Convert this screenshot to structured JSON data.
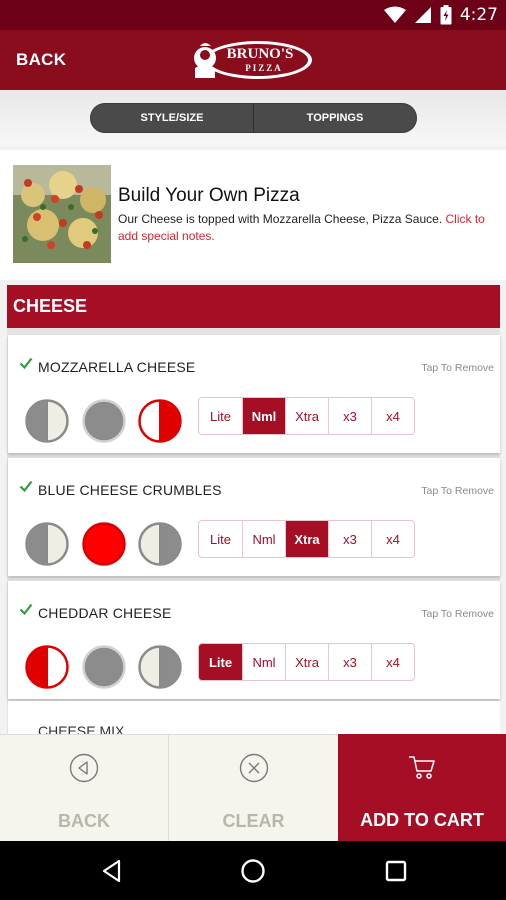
{
  "status_bar": {
    "time": "4:27"
  },
  "header": {
    "back_label": "BACK",
    "logo_text_top": "BRUNO'S",
    "logo_text_bottom": "PIZZA"
  },
  "tabs": [
    {
      "label": "STYLE/SIZE"
    },
    {
      "label": "TOPPINGS"
    }
  ],
  "product": {
    "title": "Build Your Own Pizza",
    "description": "Our Cheese is topped with Mozzarella Cheese, Pizza Sauce.",
    "note_link": "Click to add special notes."
  },
  "section": {
    "title": "CHEESE"
  },
  "amount_options": [
    "Lite",
    "Nml",
    "Xtra",
    "x3",
    "x4"
  ],
  "toppings": [
    {
      "name": "MOZZARELLA CHEESE",
      "remove_label": "Tap To Remove",
      "selected_coverage": "right",
      "selected_amount": "Nml"
    },
    {
      "name": "BLUE CHEESE CRUMBLES",
      "remove_label": "Tap To Remove",
      "selected_coverage": "whole",
      "selected_amount": "Xtra"
    },
    {
      "name": "CHEDDAR CHEESE",
      "remove_label": "Tap To Remove",
      "selected_coverage": "left",
      "selected_amount": "Lite"
    }
  ],
  "partial_item": {
    "name": "CHEESE MIX"
  },
  "bottom_bar": {
    "back_label": "BACK",
    "clear_label": "CLEAR",
    "cart_label": "ADD TO CART"
  },
  "colors": {
    "brand": "#a50e24",
    "header": "#8a0d1e",
    "status_bar": "#6b0016",
    "selected_red": "#ff0000",
    "check_green": "#2e9e3a"
  },
  "icons": [
    "wifi-icon",
    "signal-icon",
    "battery-icon",
    "checkmark-icon",
    "back-arrow-icon",
    "clear-x-icon",
    "cart-icon",
    "nav-back-icon",
    "nav-home-icon",
    "nav-recents-icon"
  ]
}
